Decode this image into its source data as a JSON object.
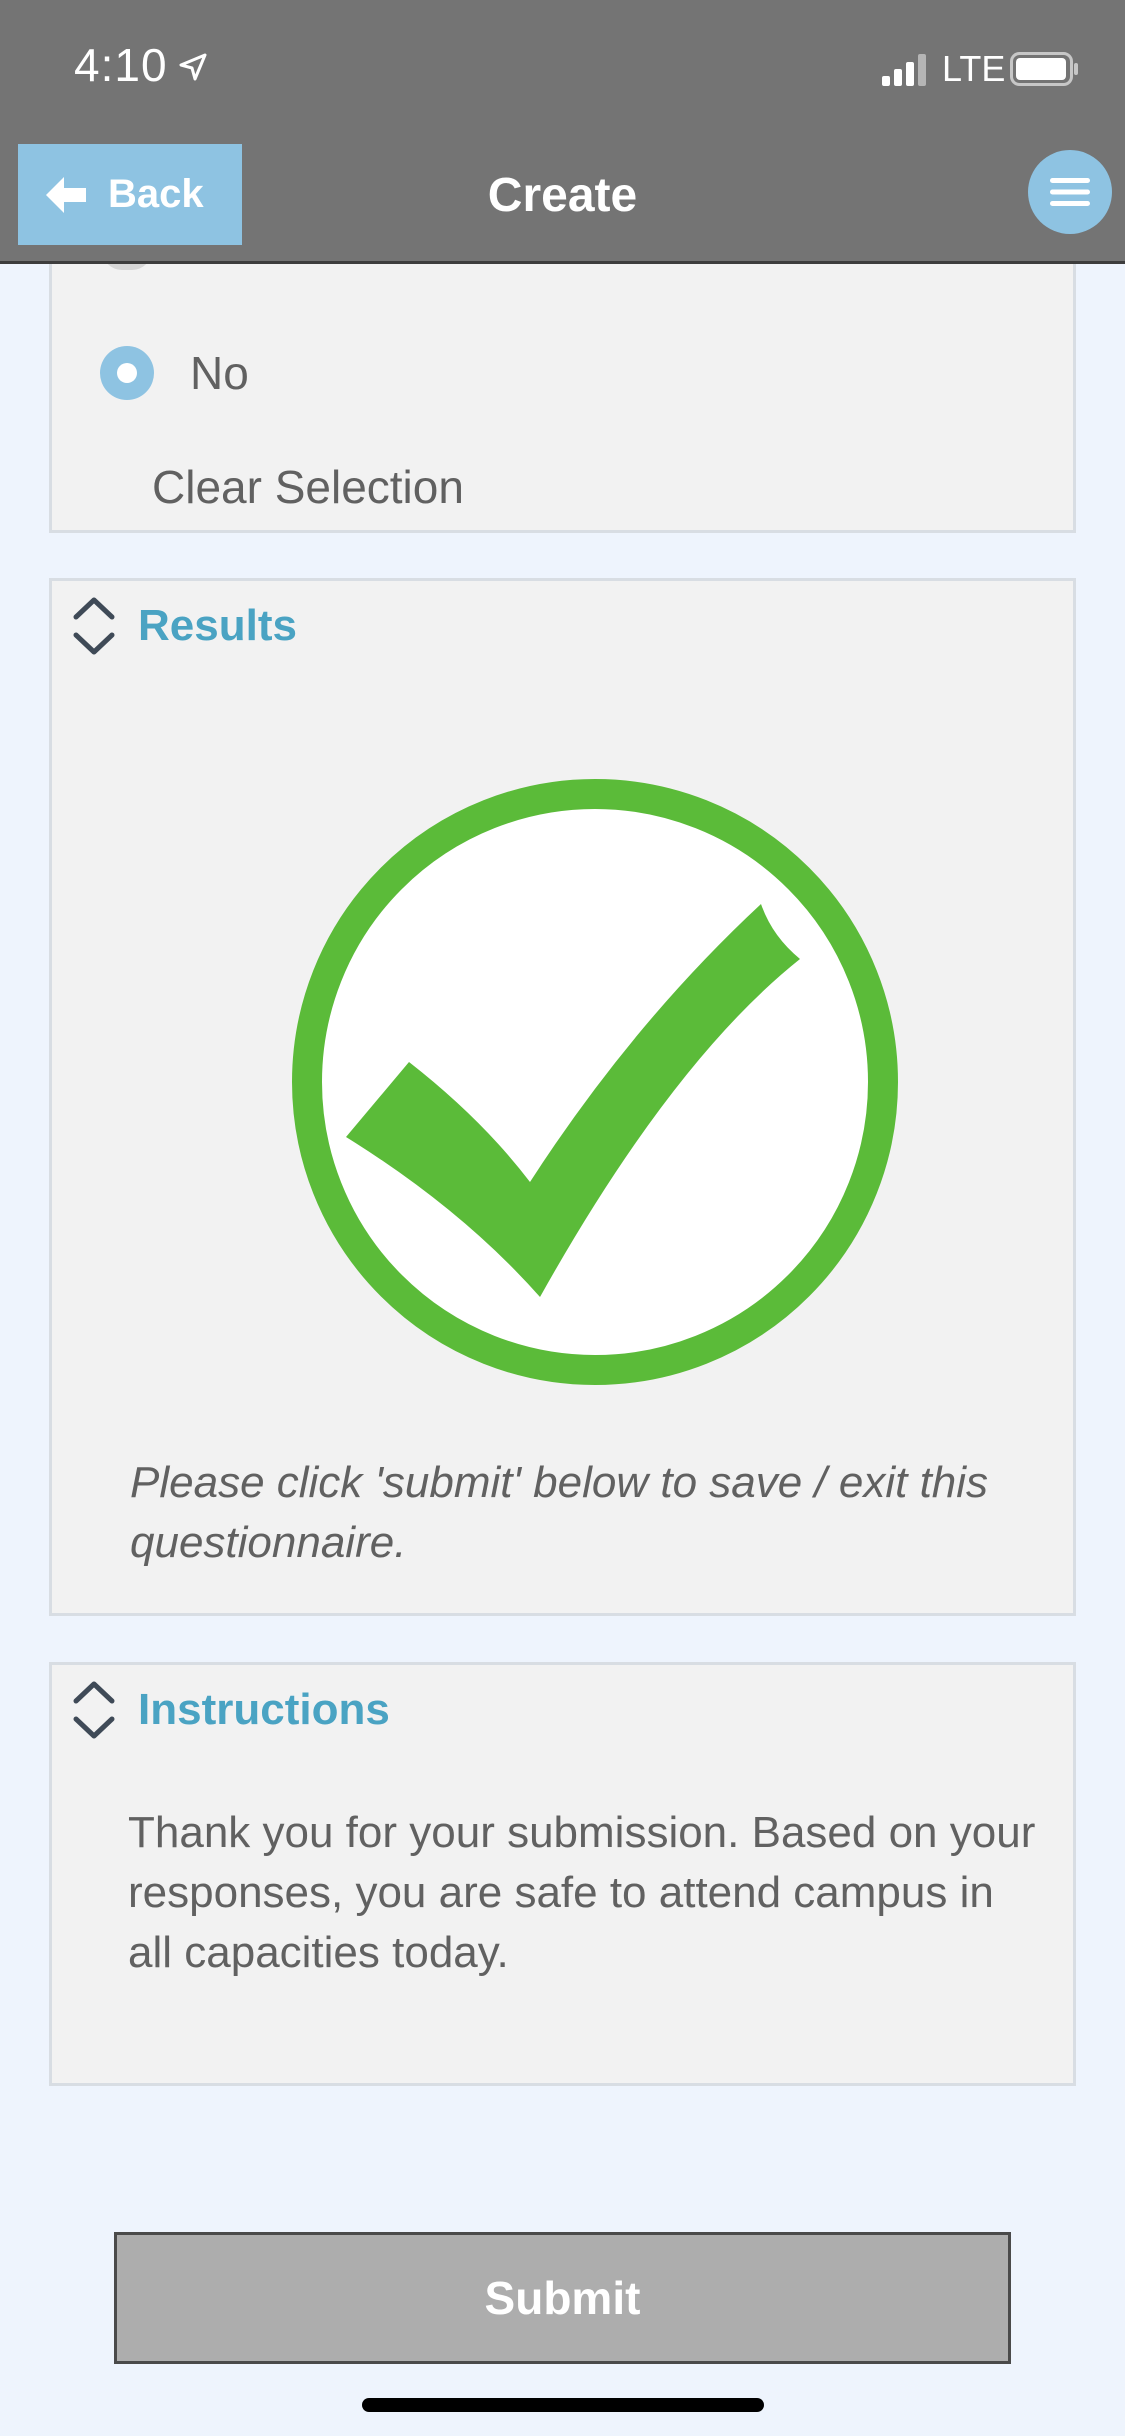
{
  "status_bar": {
    "time": "4:10",
    "network": "LTE"
  },
  "nav": {
    "back_label": "Back",
    "title": "Create"
  },
  "question": {
    "selected_option": "No",
    "clear_label": "Clear Selection"
  },
  "results": {
    "title": "Results",
    "note": "Please click 'submit' below to save / exit this questionnaire."
  },
  "instructions": {
    "title": "Instructions",
    "text": "Thank you for your submission. Based on your responses, you are safe to attend campus in all capacities today."
  },
  "submit": {
    "label": "Submit"
  },
  "colors": {
    "header_bg": "#747474",
    "accent_blue": "#8ec3e2",
    "title_blue": "#4aa3c3",
    "success_green": "#5bbb39",
    "submit_gray": "#adadad",
    "page_bg": "#eef4fd"
  },
  "icons": {
    "back": "arrow-left-icon",
    "menu": "hamburger-menu-icon",
    "collapse": "chevron-up-down-icon",
    "result": "check-circle-icon"
  }
}
